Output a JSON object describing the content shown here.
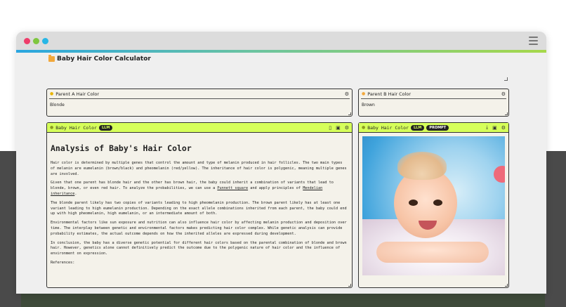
{
  "app": {
    "title": "Baby Hair Color Calculator"
  },
  "parent_a": {
    "label": "Parent A Hair Color",
    "value": "Blonde"
  },
  "parent_b": {
    "label": "Parent B Hair Color",
    "value": "Brown"
  },
  "analysis_panel": {
    "label": "Baby Hair Color",
    "badge": "LLM",
    "heading": "Analysis of Baby's Hair Color",
    "paragraphs": [
      "Hair color is determined by multiple genes that control the amount and type of melanin produced in hair follicles. The two main types of melanin are eumelanin (brown/black) and pheomelanin (red/yellow). The inheritance of hair color is polygenic, meaning multiple genes are involved.",
      "The blonde parent likely has two copies of variants leading to high pheomelanin production. The brown parent likely has at least one variant leading to high eumelanin production. Depending on the exact allele combinations inherited from each parent, the baby could end up with high pheomelanin, high eumelanin, or an intermediate amount of both.",
      "Environmental factors like sun exposure and nutrition can also influence hair color by affecting melanin production and deposition over time. The interplay between genetic and environmental factors makes predicting hair color complex. While genetic analysis can provide probability estimates, the actual outcome depends on how the inherited alleles are expressed during development.",
      "In conclusion, the baby has a diverse genetic potential for different hair colors based on the parental combination of blonde and brown hair. However, genetics alone cannot definitively predict the outcome due to the polygenic nature of hair color and the influence of environment on expression.",
      "References:"
    ],
    "p2_a": "Given that one parent has blonde hair and the other has brown hair, the baby could inherit a combination of variants that lead to blonde, brown, or even red hair. To analyze the probabilities, we can use a ",
    "p2_link1": "Punnett square",
    "p2_b": " and apply principles of ",
    "p2_link2": "Mendelian inheritance",
    "p2_c": "."
  },
  "image_panel": {
    "label": "Baby Hair Color",
    "badge_llm": "LLM",
    "badge_prompt": "PROMPT"
  },
  "icons": {
    "file": "file-icon",
    "image": "image-icon",
    "sliders": "sliders-icon",
    "download": "download-icon",
    "bulb": "bulb-icon",
    "folder": "folder-icon",
    "menu": "menu-icon"
  },
  "colors": {
    "header_green": "#d6ff5a",
    "panel_bg": "#f4f2ea",
    "accent_blue": "#2aa6e0"
  }
}
